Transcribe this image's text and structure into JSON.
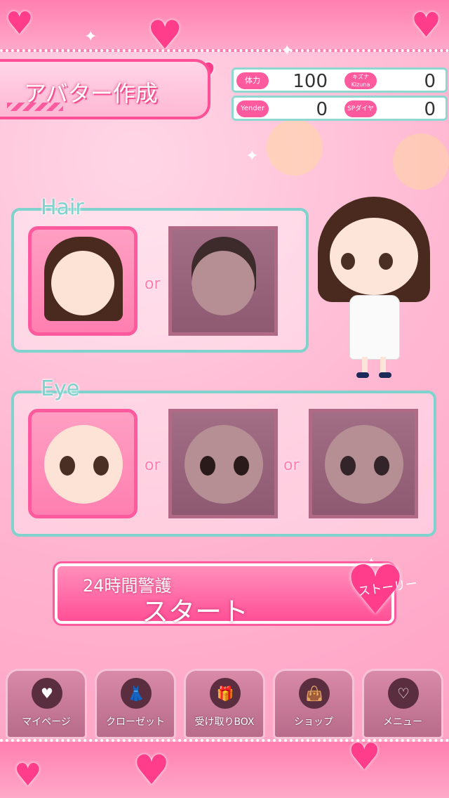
{
  "header": {
    "title": "アバター作成"
  },
  "stats": [
    {
      "label": "体力",
      "value": "100"
    },
    {
      "label": "キズナ Kizuna",
      "value": "0"
    },
    {
      "label": "Yender",
      "value": "0"
    },
    {
      "label": "SPダイヤ",
      "value": "0"
    }
  ],
  "hair_panel": {
    "label": "Hair",
    "or_text": "or"
  },
  "eye_panel": {
    "label": "Eye",
    "or_text": "or"
  },
  "start_button": {
    "subtitle": "24時間警護",
    "label": "スタート",
    "badge": "ストーリー"
  },
  "nav": [
    {
      "label": "マイページ",
      "icon": "sp-heart-icon"
    },
    {
      "label": "クローゼット",
      "icon": "dress-icon"
    },
    {
      "label": "受け取りBOX",
      "icon": "gift-icon"
    },
    {
      "label": "ショップ",
      "icon": "bag-icon"
    },
    {
      "label": "メニュー",
      "icon": "menu-icon"
    }
  ]
}
